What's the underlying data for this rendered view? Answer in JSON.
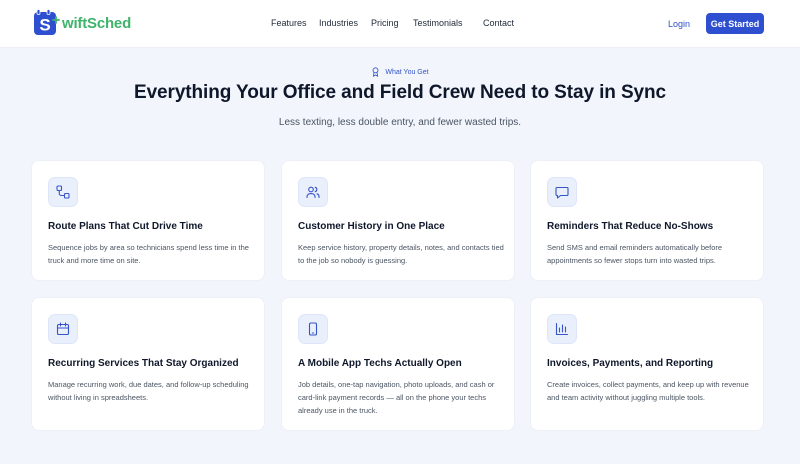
{
  "brand": {
    "name": "wiftSched",
    "accent": "#3fb36b",
    "mark_color": "#2f4fd1"
  },
  "nav": {
    "links": [
      "Features",
      "Industries",
      "Pricing",
      "Testimonials",
      "Contact"
    ],
    "login_label": "Login",
    "cta_label": "Get Started"
  },
  "hero": {
    "eyebrow": "What You Get",
    "eyebrow_icon": "badge-icon",
    "title": "Everything Your Office and Field Crew Need to Stay in Sync",
    "subtitle": "Less texting, less double entry, and fewer wasted trips."
  },
  "features": [
    {
      "icon": "route-icon",
      "title": "Route Plans That Cut Drive Time",
      "description": "Sequence jobs by area so technicians spend less time in the truck and more time on site."
    },
    {
      "icon": "users-icon",
      "title": "Customer History in One Place",
      "description": "Keep service history, property details, notes, and contacts tied to the job so nobody is guessing."
    },
    {
      "icon": "message-icon",
      "title": "Reminders That Reduce No-Shows",
      "description": "Send SMS and email reminders automatically before appointments so fewer stops turn into wasted trips."
    },
    {
      "icon": "calendar-icon",
      "title": "Recurring Services That Stay Organized",
      "description": "Manage recurring work, due dates, and follow-up scheduling without living in spreadsheets."
    },
    {
      "icon": "smartphone-icon",
      "title": "A Mobile App Techs Actually Open",
      "description": "Job details, one-tap navigation, photo uploads, and cash or card-link payment records — all on the phone your techs already use in the truck."
    },
    {
      "icon": "bar-chart-icon",
      "title": "Invoices, Payments, and Reporting",
      "description": "Create invoices, collect payments, and keep up with revenue and team activity without juggling multiple tools."
    }
  ]
}
